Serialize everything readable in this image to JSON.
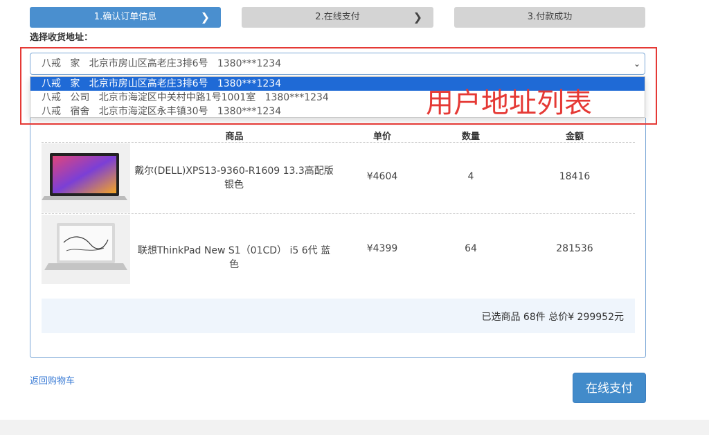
{
  "steps": [
    {
      "label": "1.确认订单信息"
    },
    {
      "label": "2.在线支付"
    },
    {
      "label": "3.付款成功"
    }
  ],
  "address": {
    "section_label": "选择收货地址：",
    "selected": "八戒   家   北京市房山区高老庄3排6号   1380***1234",
    "options": [
      "八戒   家   北京市房山区高老庄3排6号   1380***1234",
      "八戒   公司   北京市海淀区中关村中路1号1001室   1380***1234",
      "八戒   宿舍   北京市海淀区永丰镇30号   1380***1234"
    ],
    "annotation": "用户地址列表"
  },
  "table": {
    "headers": {
      "product": "商品",
      "price": "单价",
      "qty": "数量",
      "amount": "金额"
    },
    "rows": [
      {
        "name": "戴尔(DELL)XPS13-9360-R1609 13.3高配版银色",
        "price": "¥4604",
        "qty": "4",
        "amount": "18416",
        "image": "laptop-dell-xps-image"
      },
      {
        "name": "联想ThinkPad New S1（01CD） i5 6代 蓝色",
        "price": "¥4399",
        "qty": "64",
        "amount": "281536",
        "image": "laptop-thinkpad-image"
      }
    ]
  },
  "summary": {
    "text": "已选商品 68件 总价¥ 299952元"
  },
  "actions": {
    "back": "返回购物车",
    "pay": "在线支付"
  },
  "colors": {
    "primary": "#4a8fcf",
    "step_inactive": "#d4d4d4",
    "highlight": "#e53935",
    "option_selected": "#1f6ad6"
  }
}
